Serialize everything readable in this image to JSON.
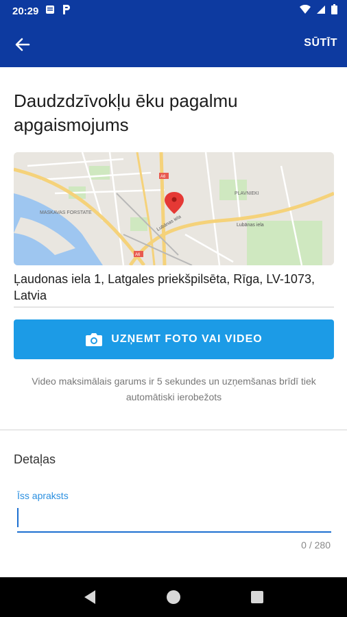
{
  "status": {
    "time": "20:29"
  },
  "appbar": {
    "submit_label": "SŪTĪT"
  },
  "title": "Daudzdzīvokļu ēku pagalmu apgaismojums",
  "map": {
    "labels": [
      "MASKAVAS FORSTATE",
      "PLAVNIEKI",
      "Lubānas iela",
      "Lubānas iela",
      "A6",
      "A6"
    ]
  },
  "address": "Ļaudonas iela 1, Latgales priekšpilsēta, Rīga, LV-1073, Latvia",
  "photo_button_label": "UZŅEMT FOTO VAI VIDEO",
  "hint": "Video maksimālais garums ir 5 sekundes un uzņemšanas brīdī tiek automātiski ierobežots",
  "details": {
    "section_title": "Detaļas",
    "field_label": "Īss apraksts",
    "field_value": "",
    "counter": "0 / 280"
  },
  "colors": {
    "primary": "#0d3aa0",
    "button": "#1c9be6",
    "accent": "#1c6fd0"
  }
}
